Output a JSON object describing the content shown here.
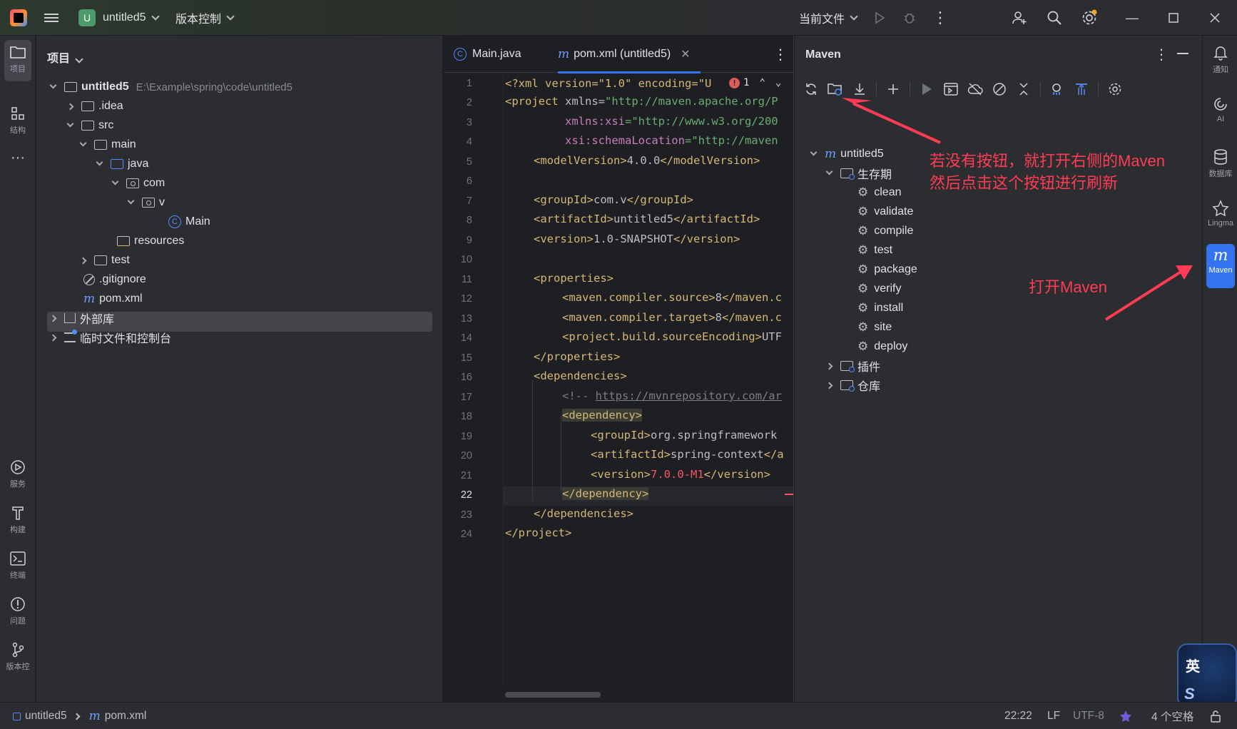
{
  "titlebar": {
    "project_badge": "U",
    "project_name": "untitled5",
    "vcs_menu": "版本控制",
    "run_config": "当前文件"
  },
  "left_strip": {
    "items": [
      {
        "label": "项目",
        "icon": "folder-icon"
      },
      {
        "label": "结构",
        "icon": "structure-icon"
      },
      {
        "label": "服务",
        "icon": "services-icon"
      },
      {
        "label": "构建",
        "icon": "build-icon"
      },
      {
        "label": "终端",
        "icon": "terminal-icon"
      },
      {
        "label": "问题",
        "icon": "problems-icon"
      },
      {
        "label": "版本控",
        "icon": "git-branch-icon"
      }
    ]
  },
  "project_panel": {
    "title": "项目",
    "tree": [
      {
        "label": "untitled5",
        "hint": "E:\\Example\\spring\\code\\untitled5"
      },
      {
        "label": ".idea"
      },
      {
        "label": "src"
      },
      {
        "label": "main"
      },
      {
        "label": "java"
      },
      {
        "label": "com"
      },
      {
        "label": "v"
      },
      {
        "label": "Main"
      },
      {
        "label": "resources"
      },
      {
        "label": "test"
      },
      {
        "label": ".gitignore"
      },
      {
        "label": "pom.xml"
      },
      {
        "label": "外部库"
      },
      {
        "label": "临时文件和控制台"
      }
    ]
  },
  "editor": {
    "tabs": [
      {
        "label": "Main.java"
      },
      {
        "label": "pom.xml (untitled5)"
      }
    ],
    "error_count": "1",
    "current_line": "22",
    "line_numbers": [
      "1",
      "2",
      "3",
      "4",
      "5",
      "6",
      "7",
      "8",
      "9",
      "10",
      "11",
      "12",
      "13",
      "14",
      "15",
      "16",
      "17",
      "18",
      "19",
      "20",
      "21",
      "22",
      "23",
      "24"
    ],
    "code": {
      "l1": "<?xml version=\"1.0\" encoding=\"U",
      "l2_tag": "<project ",
      "l2_attr": "xmlns=",
      "l2_val": "\"http://maven.apache.org/P",
      "l3_ns": "xmlns:xsi",
      "l3_val": "=\"http://www.w3.org/200",
      "l4_ns": "xsi:schemaLocation",
      "l4_val": "=\"http://maven",
      "l5_open": "<modelVersion>",
      "l5_text": "4.0.0",
      "l5_close": "</modelVersion>",
      "l7_open": "<groupId>",
      "l7_text": "com.v",
      "l7_close": "</groupId>",
      "l8_open": "<artifactId>",
      "l8_text": "untitled5",
      "l8_close": "</artifactId>",
      "l9_open": "<version>",
      "l9_text": "1.0-SNAPSHOT",
      "l9_close": "</version>",
      "l11": "<properties>",
      "l12_open": "<maven.compiler.source>",
      "l12_text": "8",
      "l12_close": "</maven.c",
      "l13_open": "<maven.compiler.target>",
      "l13_text": "8",
      "l13_close": "</maven.c",
      "l14_open": "<project.build.sourceEncoding>",
      "l14_text": "UTF",
      "l15": "</properties>",
      "l16": "<dependencies>",
      "l17_prefix": "<!-- ",
      "l17_link": "https://mvnrepository.com/ar",
      "l18": "<dependency>",
      "l19_open": "<groupId>",
      "l19_text": "org.springframework",
      "l20_open": "<artifactId>",
      "l20_text": "spring-context",
      "l20_close": "</a",
      "l21_open": "<version>",
      "l21_text": "7.0.0-M1",
      "l21_close": "</version>",
      "l22": "</dependency>",
      "l23": "</dependencies>",
      "l24": "</project>"
    }
  },
  "maven": {
    "title": "Maven",
    "root": "untitled5",
    "lifecycle_label": "生存期",
    "lifecycle": [
      "clean",
      "validate",
      "compile",
      "test",
      "package",
      "verify",
      "install",
      "site",
      "deploy"
    ],
    "plugins_label": "插件",
    "repos_label": "仓库"
  },
  "right_strip": {
    "items": [
      {
        "label": "通知",
        "icon": "bell-icon"
      },
      {
        "label": "AI",
        "icon": "ai-icon"
      },
      {
        "label": "数据库",
        "icon": "database-icon"
      },
      {
        "label": "Lingma",
        "icon": "lingma-icon"
      },
      {
        "label": "Maven",
        "icon": "maven-icon"
      }
    ]
  },
  "annotations": {
    "refresh_note_line1": "若没有按钮，就打开右侧的Maven",
    "refresh_note_line2": "然后点击这个按钮进行刷新",
    "open_maven_note": "打开Maven",
    "color": "#ff3c54"
  },
  "statusbar": {
    "breadcrumb_project": "untitled5",
    "breadcrumb_file": "pom.xml",
    "position": "22:22",
    "line_sep": "LF",
    "encoding": "UTF-8",
    "indent": "4 个空格"
  },
  "ime": {
    "mode": "英",
    "logo": "S"
  },
  "colors": {
    "accent": "#3574f0",
    "tag": "#d5b778",
    "string": "#6aab73",
    "namespace": "#c77dbb"
  }
}
